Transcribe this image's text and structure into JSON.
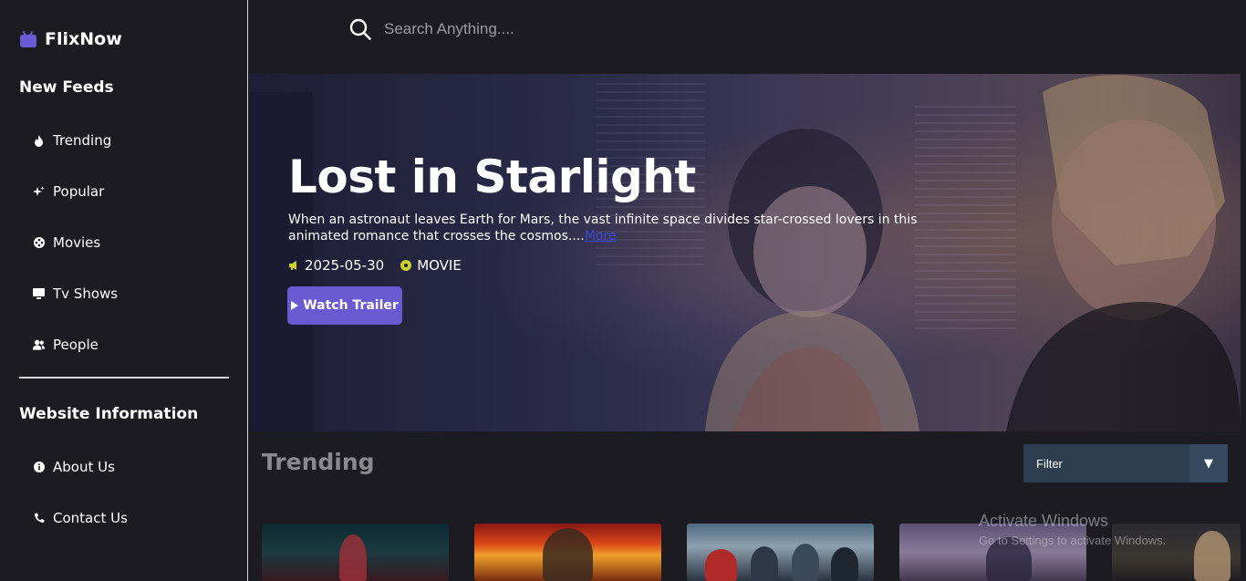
{
  "brand": {
    "name": "FlixNow",
    "accent": "#6a5ad1"
  },
  "sidebar": {
    "section1_title": "New Feeds",
    "items": [
      {
        "label": "Trending",
        "icon": "fire-icon"
      },
      {
        "label": "Popular",
        "icon": "sparkle-icon"
      },
      {
        "label": "Movies",
        "icon": "film-reel-icon"
      },
      {
        "label": "Tv Shows",
        "icon": "tv-icon"
      },
      {
        "label": "People",
        "icon": "people-icon"
      }
    ],
    "section2_title": "Website Information",
    "info_items": [
      {
        "label": "About Us",
        "icon": "info-icon"
      },
      {
        "label": "Contact Us",
        "icon": "phone-icon"
      }
    ]
  },
  "search": {
    "placeholder": "Search Anything....",
    "value": ""
  },
  "hero": {
    "title": "Lost in Starlight",
    "description": "When an astronaut leaves Earth for Mars, the vast infinite space divides star-crossed lovers in this animated romance that crosses the cosmos....",
    "more_label": "More",
    "release_date": "2025-05-30",
    "media_type": "MOVIE",
    "watch_label": "Watch Trailer",
    "date_icon_color": "#c9d12a",
    "type_icon_color": "#c9d12a"
  },
  "trending": {
    "title": "Trending",
    "filter": {
      "selected": "Filter",
      "arrow": "▼"
    }
  },
  "watermark": {
    "title": "Activate Windows",
    "subtitle": "Go to Settings to activate Windows."
  }
}
